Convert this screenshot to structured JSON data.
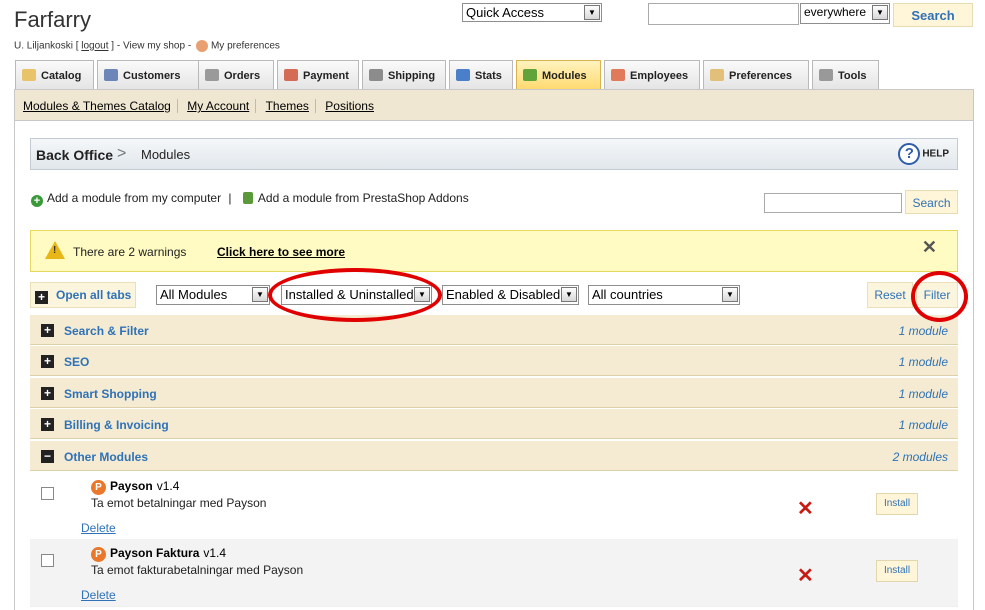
{
  "shop": {
    "name": "Farfarry"
  },
  "user": {
    "name": "U. Liljankoski",
    "open": "[",
    "logout": "logout",
    "close": "]",
    "sep1": "-",
    "view_shop": "View my shop",
    "sep2": "-",
    "preferences": "My preferences"
  },
  "quick_access": {
    "label": "Quick Access"
  },
  "search": {
    "value": "",
    "scope": "everywhere",
    "button": "Search"
  },
  "tabs": [
    {
      "label": "Catalog",
      "icon": "folder-icon",
      "active": false
    },
    {
      "label": "Customers",
      "icon": "customers-icon",
      "active": false
    },
    {
      "label": "Orders",
      "icon": "cart-icon",
      "active": false
    },
    {
      "label": "Payment",
      "icon": "payment-icon",
      "active": false
    },
    {
      "label": "Shipping",
      "icon": "truck-icon",
      "active": false
    },
    {
      "label": "Stats",
      "icon": "chart-icon",
      "active": false
    },
    {
      "label": "Modules",
      "icon": "puzzle-icon",
      "active": true
    },
    {
      "label": "Employees",
      "icon": "employee-icon",
      "active": false
    },
    {
      "label": "Preferences",
      "icon": "preferences-icon",
      "active": false
    },
    {
      "label": "Tools",
      "icon": "wrench-icon",
      "active": false
    }
  ],
  "subnav": [
    "Modules & Themes Catalog",
    "My Account",
    "Themes",
    "Positions"
  ],
  "breadcrumb": {
    "root": "Back Office",
    "sep": ">",
    "page": "Modules",
    "help": "HELP",
    "help_glyph": "?"
  },
  "actions": {
    "add_computer": "Add a module from my computer",
    "sep": "|",
    "add_addons": "Add a module from PrestaShop Addons",
    "search_button": "Search"
  },
  "warning": {
    "icon_glyph": "!",
    "text": "There are 2 warnings",
    "link": "Click here to see more",
    "close": "✕"
  },
  "filters": {
    "open_all": "Open all tabs",
    "category": "All Modules",
    "install_state": "Installed & Uninstalled",
    "enabled_state": "Enabled & Disabled",
    "country": "All countries",
    "reset": "Reset",
    "filter": "Filter"
  },
  "categories": [
    {
      "name": "Search & Filter",
      "count": "1 module",
      "expanded": false
    },
    {
      "name": "SEO",
      "count": "1 module",
      "expanded": false
    },
    {
      "name": "Smart Shopping",
      "count": "1 module",
      "expanded": false
    },
    {
      "name": "Billing & Invoicing",
      "count": "1 module",
      "expanded": false
    },
    {
      "name": "Other Modules",
      "count": "2 modules",
      "expanded": true
    }
  ],
  "modules": [
    {
      "name": "Payson",
      "version": "v1.4",
      "description": "Ta emot betalningar med Payson",
      "delete": "Delete",
      "status": "✕",
      "install": "Install",
      "icon": "P"
    },
    {
      "name": "Payson Faktura",
      "version": "v1.4",
      "description": "Ta emot fakturabetalningar med Payson",
      "delete": "Delete",
      "status": "✕",
      "install": "Install",
      "icon": "P"
    }
  ],
  "glyphs": {
    "expand": "+",
    "collapse": "−",
    "dropdown": "▼",
    "plus": "+"
  },
  "colors": {
    "accent": "#2f72b7",
    "active_tab": "#ffd96e",
    "warning_bg": "#fffbc3",
    "annotation": "#e00000",
    "status_error": "#c81a12"
  }
}
